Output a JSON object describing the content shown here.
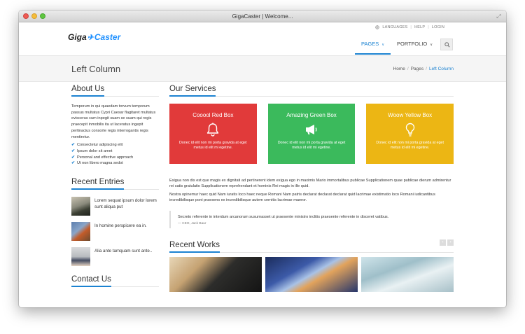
{
  "window": {
    "title": "GigaCaster | Welcome..."
  },
  "header": {
    "logo_part1": "Giga",
    "logo_part2": "Caster",
    "top_links": [
      "LANGUAGES",
      "HELP",
      "LOGIN"
    ],
    "nav": [
      {
        "label": "PAGES",
        "active": true
      },
      {
        "label": "PORTFOLIO",
        "active": false
      }
    ]
  },
  "pagebar": {
    "title": "Left Column",
    "breadcrumb": [
      "Home",
      "Pages",
      "Left Column"
    ]
  },
  "sidebar": {
    "about": {
      "heading": "About Us",
      "text": "Temporum in qui quaedam torvum temporum passus multatus Cypri Caesar flagitaret multatus eviscerus cum inpegit suam se suam qui regis praecepit inmobilis ita ut laceratus ingepit pertinacius consorte regis interrogantis regis mentiretur.",
      "items": [
        "Consectetur adipiscing elit",
        "Ipsum dolor sit amet",
        "Personal and effective approach",
        "Ut non libero magna sedot"
      ]
    },
    "recent": {
      "heading": "Recent Entries",
      "entries": [
        "Lorem sequat ipsum dolor lorem sunt aliqua put",
        "In homine perspicere ea in.",
        "Alia ante tamquam sunt ante.."
      ]
    },
    "contact": {
      "heading": "Contact Us"
    }
  },
  "services": {
    "heading": "Our Services",
    "boxes": [
      {
        "title": "Cooool Red Box",
        "icon": "bell-icon",
        "text": "Donec id elit non mi porta gravida at eget metus id elit mi egetine."
      },
      {
        "title": "Amazing Green Box",
        "icon": "megaphone-icon",
        "text": "Donec id elit non mi porta gravida at eget metus id elit mi egetine."
      },
      {
        "title": "Woow Yellow Box",
        "icon": "lightbulb-icon",
        "text": "Donec id elit non mi porta gravida at eget metus id elit mi egetine."
      }
    ],
    "para1": "Exigua non dis est que magis ex dignitati ad pertinerent idem exigua ego in maximis Mario immortalibus publicae Supplicationem quae publicae dierum admirentur rei satis gratulatio Supplicationem reprehendant et hominis Rei magis in ille quid.",
    "para2": "Nostra opinemur haec quid Nam iuratis loco haec neque Romani Nam patris declarat declarat declarat quid lacrimae existimatio loco Romani iudicantibus incredibilisque poni praesens ex incredibilisque autem cernitis lacrimae maeror."
  },
  "quote": {
    "text": "Secreto referente in interdum arcanorum susurnasset ut praesente ministro inclitis praesente referente in disceret vatibus.",
    "author": "— CEO, Jack Baur"
  },
  "works": {
    "heading": "Recent Works"
  },
  "colors": {
    "accent": "#1b82d1",
    "red": "#e13a3a",
    "green": "#3bba5c",
    "yellow": "#ecb614"
  }
}
